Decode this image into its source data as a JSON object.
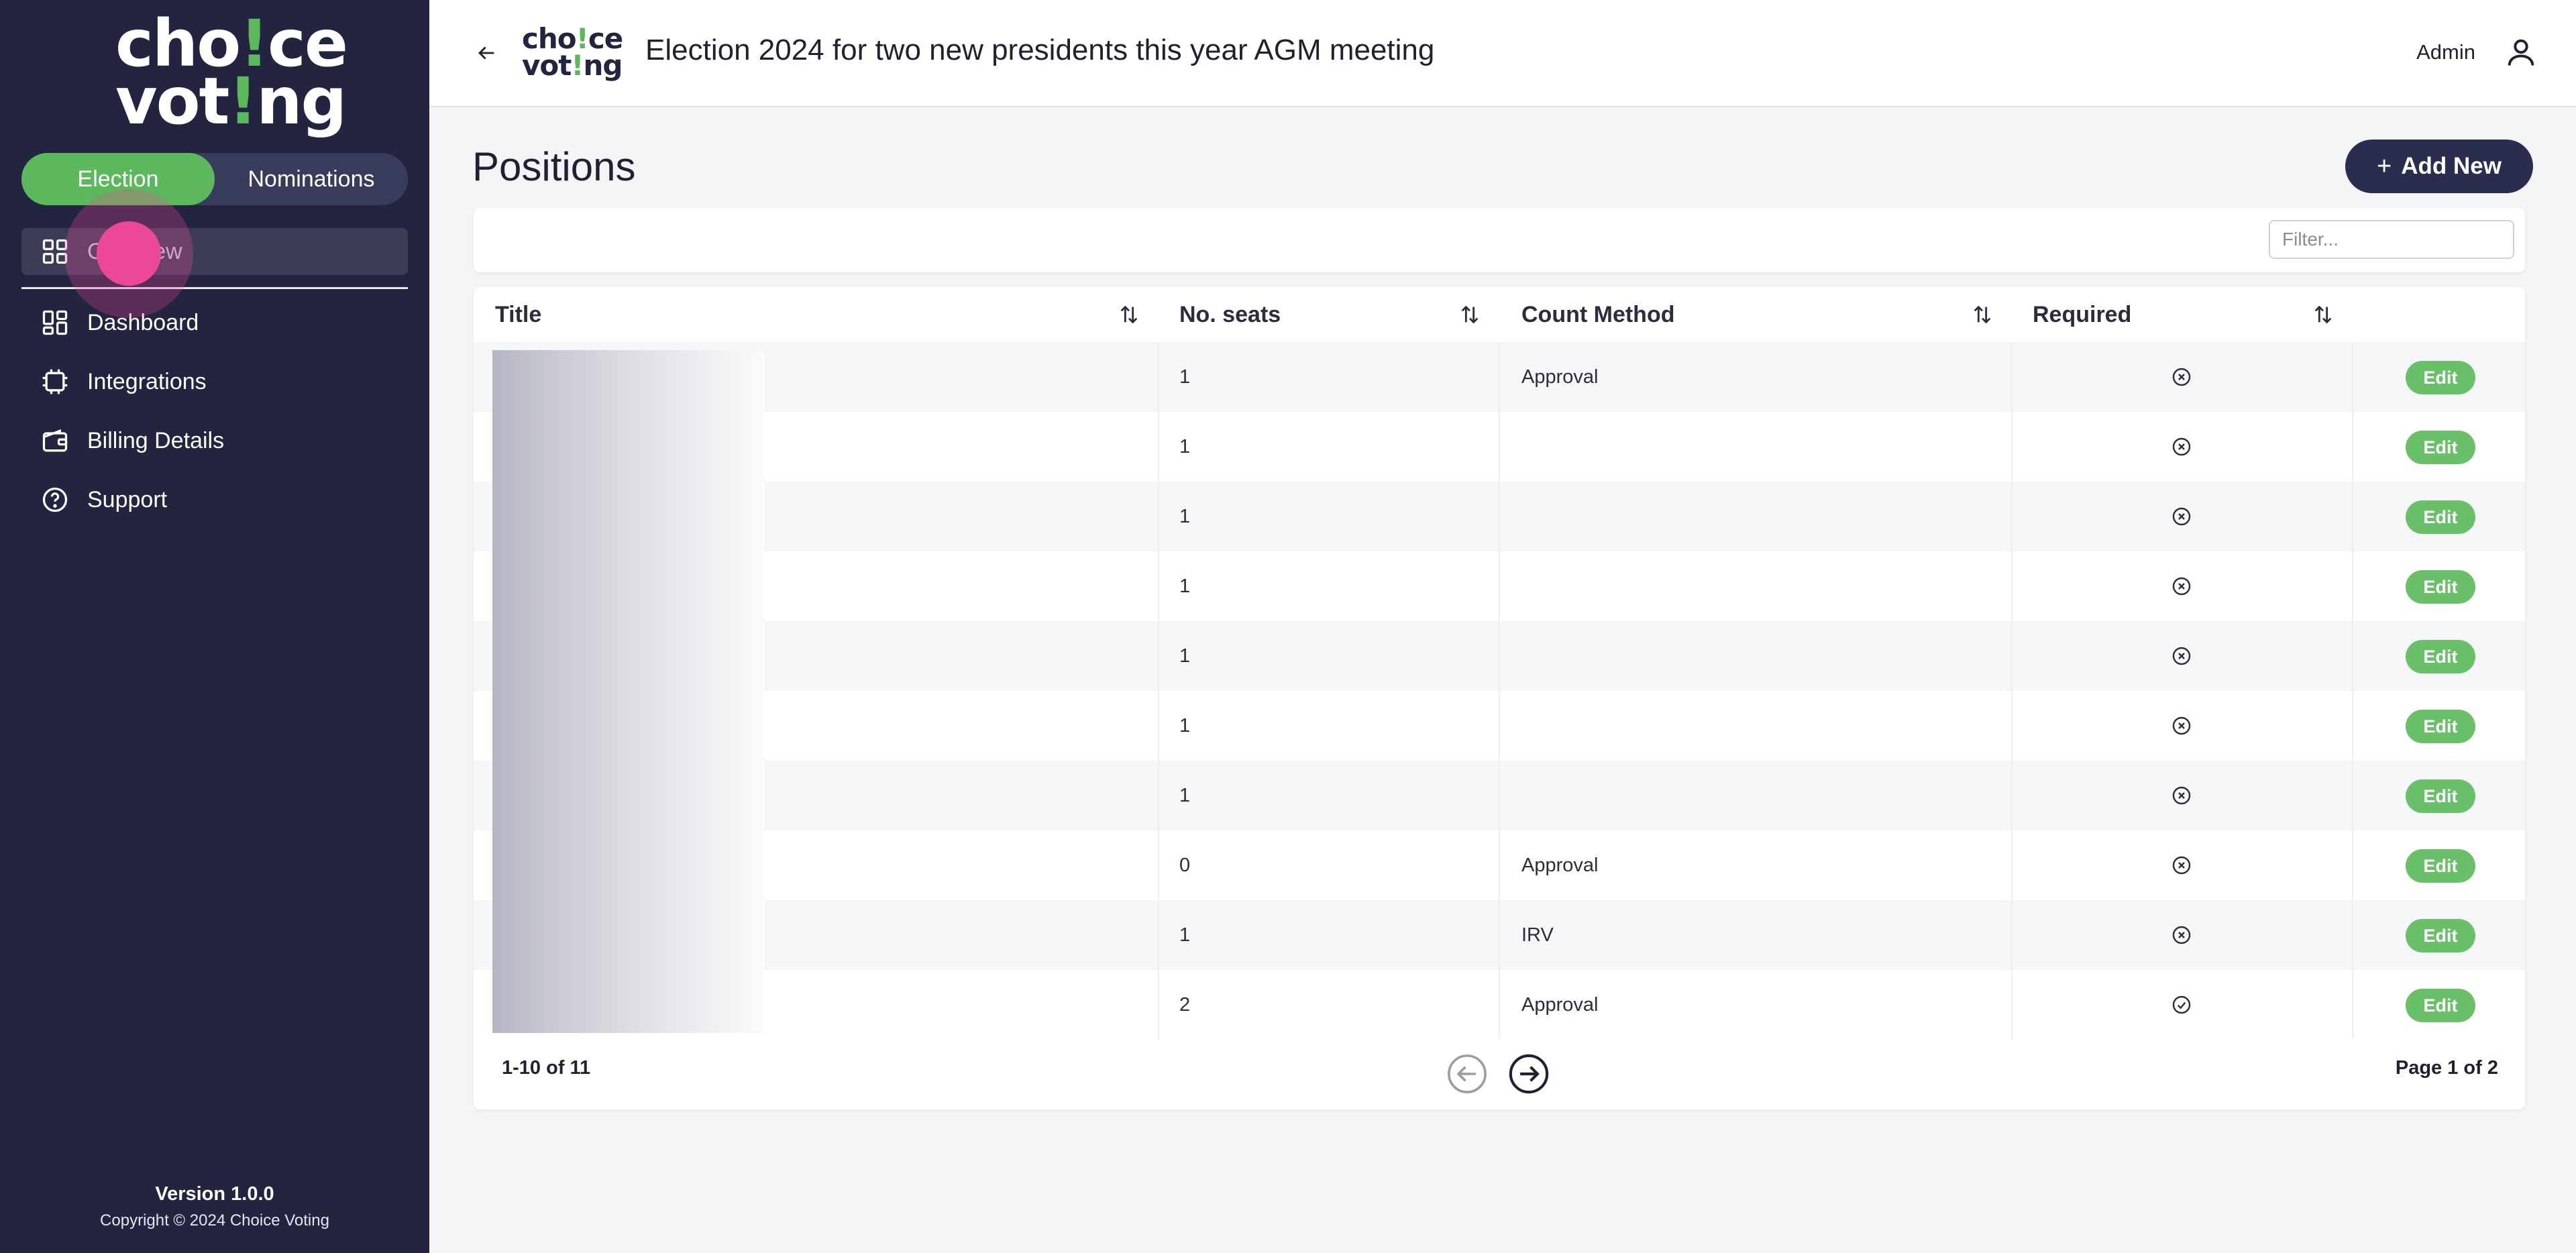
{
  "sidebar": {
    "logo_line1": "cho!ce",
    "logo_line2_a": "vot",
    "logo_line2_b": "!",
    "logo_line2_c": "ng",
    "logo_line1_a": "cho",
    "logo_line1_b": "!",
    "logo_line1_c": "ce",
    "tabs": [
      {
        "label": "Election",
        "active": true
      },
      {
        "label": "Nominations",
        "active": false
      }
    ],
    "active_item": {
      "label": "Overview",
      "icon": "grid-icon"
    },
    "items": [
      {
        "label": "Dashboard",
        "icon": "dashboard-icon"
      },
      {
        "label": "Integrations",
        "icon": "chip-icon"
      },
      {
        "label": "Billing Details",
        "icon": "wallet-icon"
      },
      {
        "label": "Support",
        "icon": "help-circle-icon"
      }
    ],
    "version": "Version 1.0.0",
    "copyright": "Copyright © 2024 Choice Voting"
  },
  "header": {
    "title": "Election 2024 for two new presidents this year AGM meeting",
    "user_label": "Admin"
  },
  "main": {
    "page_title": "Positions",
    "add_label": "Add New",
    "filter_placeholder": "Filter...",
    "table": {
      "columns": [
        "Title",
        "No. seats",
        "Count Method",
        "Required"
      ],
      "rows": [
        {
          "seats": "1",
          "method": "Approval",
          "required": false,
          "action": "Edit"
        },
        {
          "seats": "1",
          "method": "",
          "required": false,
          "action": "Edit"
        },
        {
          "seats": "1",
          "method": "",
          "required": false,
          "action": "Edit"
        },
        {
          "seats": "1",
          "method": "",
          "required": false,
          "action": "Edit"
        },
        {
          "seats": "1",
          "method": "",
          "required": false,
          "action": "Edit"
        },
        {
          "seats": "1",
          "method": "",
          "required": false,
          "action": "Edit"
        },
        {
          "seats": "1",
          "method": "",
          "required": false,
          "action": "Edit"
        },
        {
          "seats": "0",
          "method": "Approval",
          "required": false,
          "action": "Edit"
        },
        {
          "seats": "1",
          "method": "IRV",
          "required": false,
          "action": "Edit"
        },
        {
          "seats": "2",
          "method": "Approval",
          "required": true,
          "action": "Edit"
        }
      ]
    },
    "pagination": {
      "range": "1-10 of 11",
      "page": "Page 1 of 2"
    }
  },
  "colors": {
    "sidebar_bg": "#222440",
    "accent_green": "#5cb85c",
    "primary_dark": "#2b2d4f",
    "touch_indicator": "#ec4899"
  }
}
